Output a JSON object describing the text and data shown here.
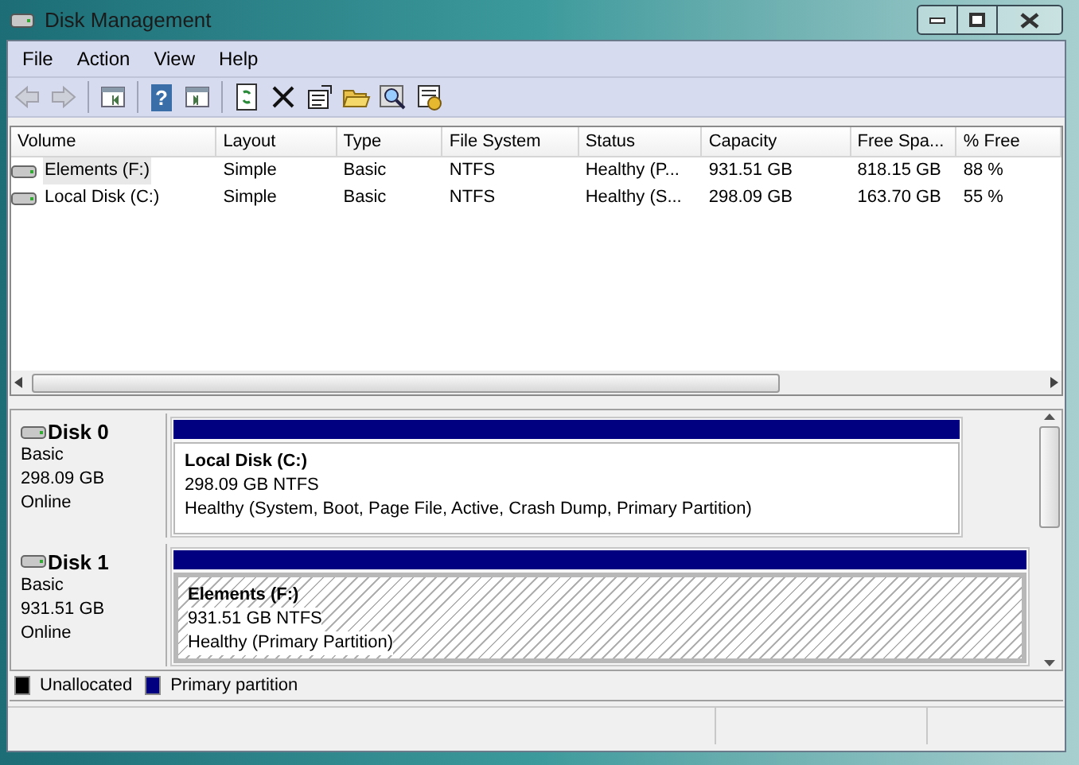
{
  "window": {
    "title": "Disk Management"
  },
  "menu": [
    "File",
    "Action",
    "View",
    "Help"
  ],
  "toolbar": [
    {
      "kind": "back",
      "disabled": true
    },
    {
      "kind": "forward",
      "disabled": true
    },
    {
      "kind": "sep"
    },
    {
      "kind": "tree",
      "disabled": false
    },
    {
      "kind": "sep"
    },
    {
      "kind": "help",
      "disabled": false,
      "label": "?"
    },
    {
      "kind": "pane",
      "disabled": false
    },
    {
      "kind": "sep"
    },
    {
      "kind": "refresh",
      "disabled": false
    },
    {
      "kind": "delete",
      "disabled": false
    },
    {
      "kind": "properties",
      "disabled": false
    },
    {
      "kind": "open",
      "disabled": false
    },
    {
      "kind": "find",
      "disabled": false
    },
    {
      "kind": "settings",
      "disabled": false
    }
  ],
  "volumes": {
    "columns": [
      "Volume",
      "Layout",
      "Type",
      "File System",
      "Status",
      "Capacity",
      "Free Spa...",
      "% Free"
    ],
    "rows": [
      {
        "selected": true,
        "cells": [
          "Elements (F:)",
          "Simple",
          "Basic",
          "NTFS",
          "Healthy (P...",
          "931.51 GB",
          "818.15 GB",
          "88 %"
        ]
      },
      {
        "selected": false,
        "cells": [
          "Local Disk (C:)",
          "Simple",
          "Basic",
          "NTFS",
          "Healthy (S...",
          "298.09 GB",
          "163.70 GB",
          "55 %"
        ]
      }
    ]
  },
  "disks": [
    {
      "name": "Disk 0",
      "type": "Basic",
      "size": "298.09 GB",
      "status": "Online",
      "partitions": [
        {
          "name": "Local Disk  (C:)",
          "size": "298.09 GB NTFS",
          "status": "Healthy (System, Boot, Page File, Active, Crash Dump, Primary Partition)",
          "selected": false
        }
      ]
    },
    {
      "name": "Disk 1",
      "type": "Basic",
      "size": "931.51 GB",
      "status": "Online",
      "partitions": [
        {
          "name": "Elements  (F:)",
          "size": "931.51 GB NTFS",
          "status": "Healthy (Primary Partition)",
          "selected": true
        }
      ]
    }
  ],
  "legend": [
    {
      "label": "Unallocated",
      "color": "#000000"
    },
    {
      "label": "Primary partition",
      "color": "#000080"
    }
  ]
}
